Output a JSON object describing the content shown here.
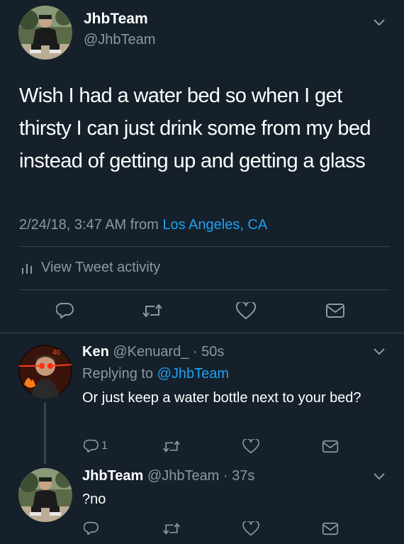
{
  "main_tweet": {
    "display_name": "JhbTeam",
    "handle": "@JhbTeam",
    "text": "Wish I had a water bed so when I get thirsty I can just drink some from my bed instead of getting up and getting a glass",
    "timestamp": "2/24/18, 3:47 AM from ",
    "location": "Los Angeles, CA",
    "activity_label": "View Tweet activity"
  },
  "replies": [
    {
      "display_name": "Ken",
      "handle": "@Kenuard_",
      "time": " · 50s",
      "replying_prefix": "Replying to ",
      "replying_to": "@JhbTeam",
      "text": "Or just keep a water bottle next to your bed?",
      "reply_count": "1"
    },
    {
      "display_name": "JhbTeam",
      "handle": "@JhbTeam",
      "time": " · 37s",
      "text": "?no"
    }
  ],
  "colors": {
    "background": "#15202b",
    "secondary_text": "#8899a6",
    "link": "#1da1f2",
    "divider": "#38444d"
  },
  "icons": [
    "caret-down-icon",
    "stats-bars-icon",
    "reply-icon",
    "retweet-icon",
    "like-icon",
    "message-icon"
  ]
}
